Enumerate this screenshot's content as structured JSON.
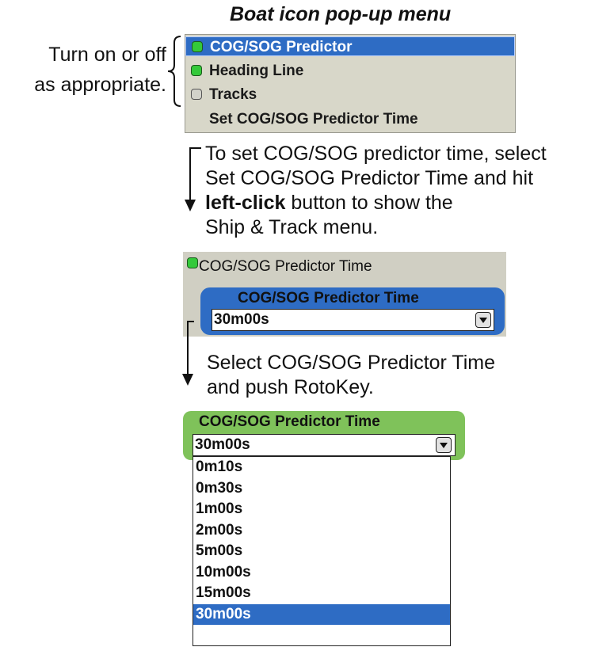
{
  "title": "Boat icon pop-up menu",
  "side_note": [
    "Turn on or off",
    "as appropriate."
  ],
  "popup_menu": {
    "items": [
      {
        "label": "COG/SOG Predictor",
        "state": "on",
        "selected": true
      },
      {
        "label": "Heading Line",
        "state": "on",
        "selected": false
      },
      {
        "label": "Tracks",
        "state": "off",
        "selected": false
      },
      {
        "label": "Set COG/SOG Predictor Time",
        "state": "",
        "selected": false
      }
    ]
  },
  "step1": {
    "line1": "To set COG/SOG predictor time, select",
    "line2": "Set COG/SOG Predictor Time and hit",
    "line3_bold": "left-click",
    "line3_rest": " button to show the",
    "line4": "Ship & Track menu."
  },
  "predictor_box": {
    "item_label": "COG/SOG Predictor Time",
    "panel_title": "COG/SOG Predictor Time",
    "value": "30m00s"
  },
  "step2": {
    "line1": "Select COG/SOG Predictor Time",
    "line2": "and push RotoKey."
  },
  "dropdown": {
    "title": "COG/SOG Predictor Time",
    "value": "30m00s",
    "options": [
      "0m10s",
      "0m30s",
      "1m00s",
      "2m00s",
      "5m00s",
      "10m00s",
      "15m00s",
      "30m00s"
    ],
    "selected_index": 7
  },
  "colors": {
    "selection_blue": "#2e6cc4",
    "lamp_green": "#34c93a",
    "panel_green": "#7fc25a",
    "menu_bg": "#d8d7c9"
  }
}
